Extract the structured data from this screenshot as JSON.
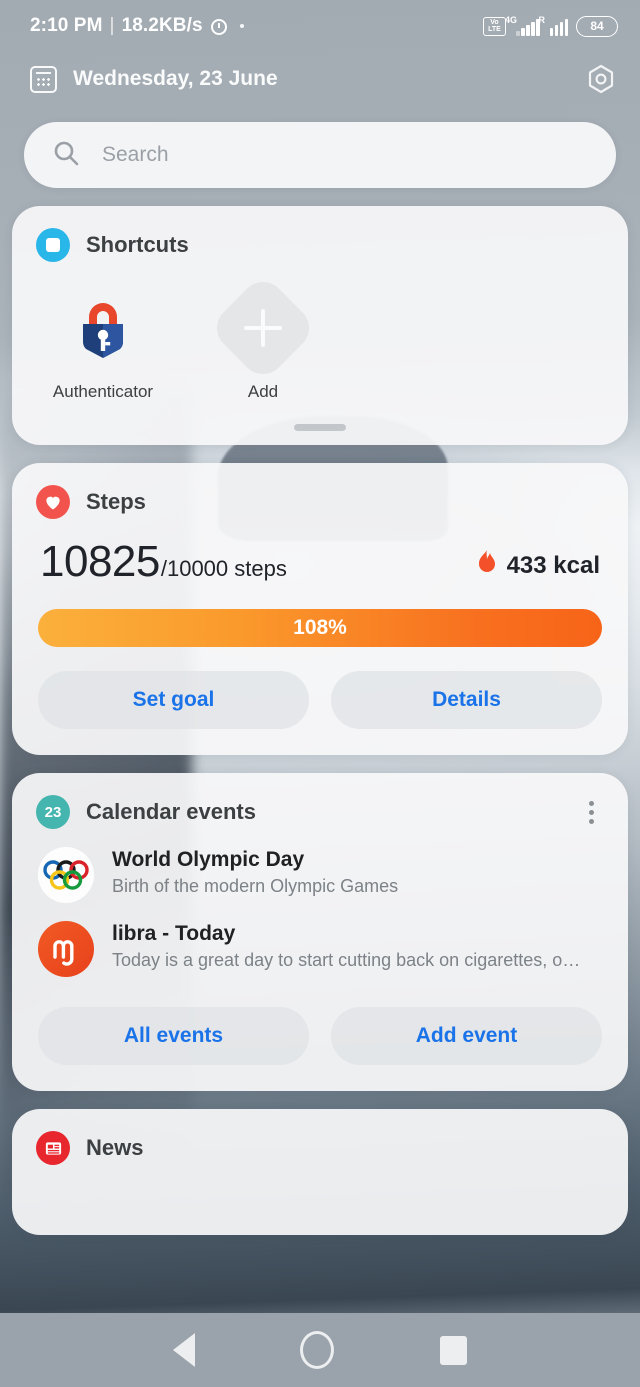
{
  "statusbar": {
    "time": "2:10 PM",
    "separator": "|",
    "network_speed": "18.2KB/s",
    "alarm_icon": "alarm-clock-icon",
    "volte_top": "Vo",
    "volte_bottom": "LTE",
    "sim1_label": "4G",
    "sim2_label": "R",
    "battery_percent": "84"
  },
  "header": {
    "calendar_icon": "calendar-icon",
    "date": "Wednesday, 23 June",
    "settings_icon": "hexagon-settings-icon"
  },
  "search": {
    "icon": "search-icon",
    "placeholder": "Search",
    "value": ""
  },
  "shortcuts": {
    "icon": "shortcuts-icon",
    "title": "Shortcuts",
    "items": [
      {
        "label": "Authenticator",
        "icon": "authenticator-padlock-icon"
      },
      {
        "label": "Add",
        "icon": "plus-icon"
      }
    ],
    "drag_handle": "drag-handle"
  },
  "steps": {
    "icon": "heart-icon",
    "title": "Steps",
    "count": "10825",
    "goal_suffix": "/10000 steps",
    "calories": "433 kcal",
    "flame_icon": "flame-icon",
    "progress_label": "108%",
    "progress_percent": 108,
    "buttons": [
      {
        "label": "Set goal"
      },
      {
        "label": "Details"
      }
    ]
  },
  "calendar": {
    "badge_number": "23",
    "title": "Calendar events",
    "menu_icon": "kebab-menu-icon",
    "events": [
      {
        "title": "World Olympic Day",
        "description": "Birth of the modern Olympic Games",
        "icon": "olympic-rings-icon"
      },
      {
        "title": "libra - Today",
        "description": "Today is a great day to start cutting back on cigarettes, or a…",
        "icon": "zodiac-libra-icon"
      }
    ],
    "buttons": [
      {
        "label": "All events"
      },
      {
        "label": "Add event"
      }
    ]
  },
  "news": {
    "icon": "newspaper-icon",
    "title": "News"
  },
  "navbar": {
    "back": "back-button",
    "home": "home-button",
    "recents": "recents-button"
  },
  "colors": {
    "accent_blue": "#1a73e8",
    "shortcuts_blue": "#29b6e8",
    "steps_red": "#f2544d",
    "calendar_teal": "#45b5b0",
    "news_red": "#e8262d",
    "progress_start": "#fbb03c",
    "progress_end": "#f76418"
  }
}
